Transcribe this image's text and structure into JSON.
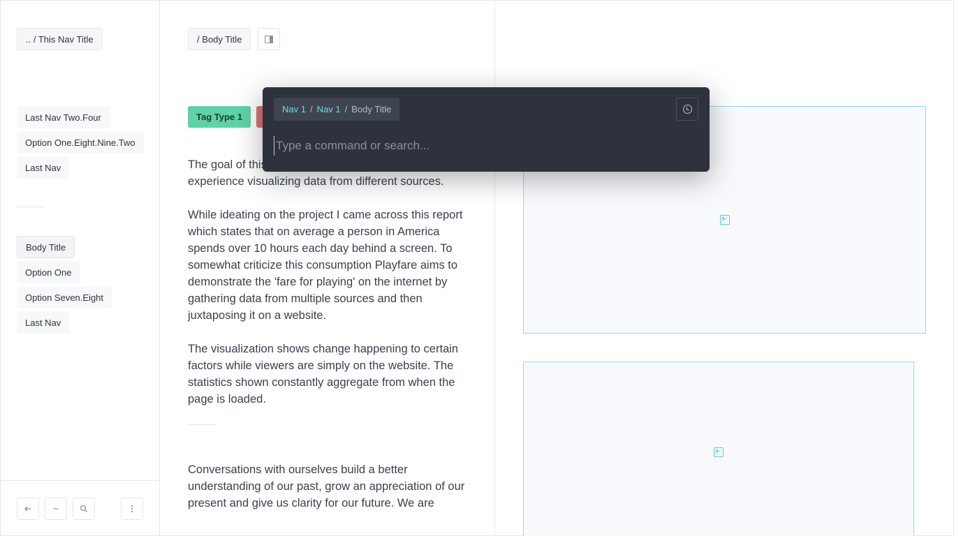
{
  "sidebar": {
    "nav_title": ".. / This Nav Title",
    "group1": [
      {
        "label": "Last Nav Two.Four"
      },
      {
        "label": "Option One.Eight.Nine.Two"
      },
      {
        "label": "Last Nav"
      }
    ],
    "group2": [
      {
        "label": "Body Title",
        "active": true
      },
      {
        "label": "Option One"
      },
      {
        "label": "Option Seven.Eight"
      },
      {
        "label": "Last Nav"
      }
    ],
    "footer": {
      "back_icon": "arrow-left-icon",
      "home_icon": "tilde-icon",
      "home_glyph": "~",
      "search_icon": "search-icon",
      "more_icon": "vertical-dots-icon"
    }
  },
  "body": {
    "title_button": "/ Body Title",
    "panel_toggle_icon": "panel-right-icon",
    "tags": [
      {
        "label": "Tag Type 1",
        "color": "#5fd3a8"
      },
      {
        "label": "",
        "color": "#d9727a"
      }
    ],
    "paragraphs": [
      "The goal of this project was to create an interactive experience visualizing data from different sources.",
      "While ideating on the project I came across this report which states that on average a person in America spends over 10 hours each day behind a screen. To somewhat criticize this consumption Playfare aims to demonstrate the 'fare for playing' on the internet by gathering data from multiple sources and then juxtaposing it on a website.",
      "The visualization shows change happening to certain factors while viewers are simply on the website. The statistics shown constantly aggregate from when the page is loaded."
    ],
    "paragraph_after_divider": "Conversations with ourselves build a better understanding of our past, grow an appreciation of our present and give us clarity for our future. We are"
  },
  "right_panel": {
    "images": [
      {
        "icon": "image-icon"
      },
      {
        "icon": "image-icon"
      }
    ],
    "border_color": "#8fdfe0"
  },
  "palette": {
    "breadcrumb": [
      {
        "label": "Nav 1",
        "link": true
      },
      {
        "label": "Nav 1",
        "link": true
      },
      {
        "label": "Body Title",
        "link": false
      }
    ],
    "separator": "/",
    "history_icon": "history-icon",
    "input_value": "",
    "input_placeholder": "Type a command or search...",
    "background": "#2d323c",
    "accent": "#78d6e6"
  }
}
